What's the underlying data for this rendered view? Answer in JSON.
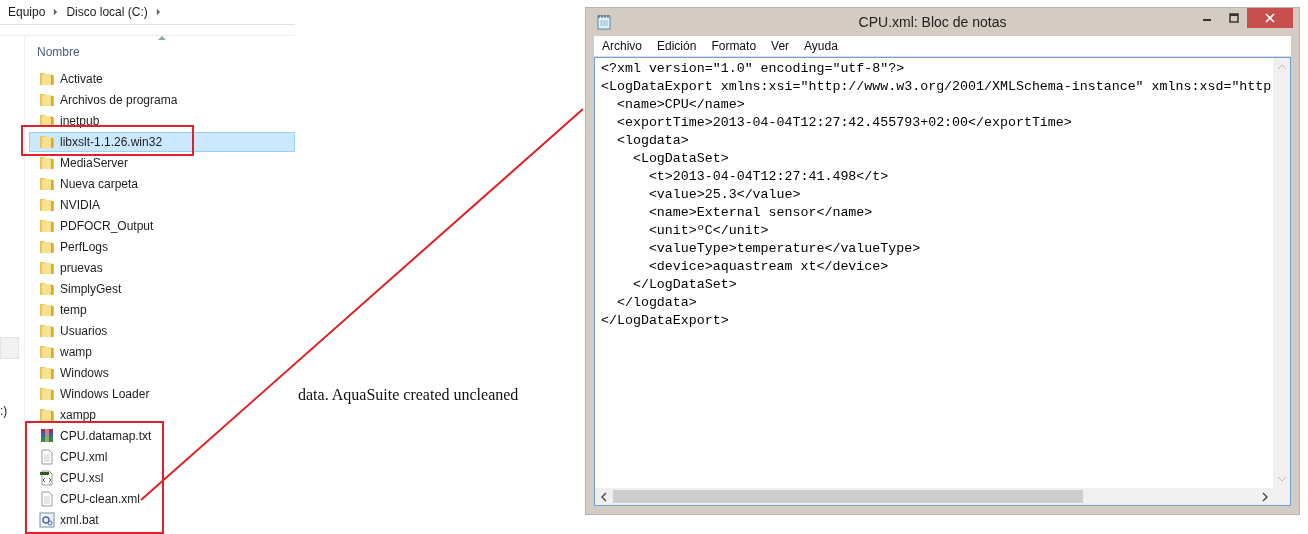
{
  "explorer": {
    "breadcrumb": [
      "Equipo",
      "Disco local (C:)"
    ],
    "column_header": "Nombre",
    "nav_pane_text": ":)",
    "items": [
      {
        "name": "Activate",
        "kind": "folder",
        "selected": false
      },
      {
        "name": "Archivos de programa",
        "kind": "folder",
        "selected": false
      },
      {
        "name": "inetpub",
        "kind": "folder",
        "selected": false
      },
      {
        "name": "libxslt-1.1.26.win32",
        "kind": "folder",
        "selected": true
      },
      {
        "name": "MediaServer",
        "kind": "folder",
        "selected": false
      },
      {
        "name": "Nueva carpeta",
        "kind": "folder",
        "selected": false
      },
      {
        "name": "NVIDIA",
        "kind": "folder",
        "selected": false
      },
      {
        "name": "PDFOCR_Output",
        "kind": "folder",
        "selected": false
      },
      {
        "name": "PerfLogs",
        "kind": "folder",
        "selected": false
      },
      {
        "name": "pruevas",
        "kind": "folder",
        "selected": false
      },
      {
        "name": "SimplyGest",
        "kind": "folder",
        "selected": false
      },
      {
        "name": "temp",
        "kind": "folder",
        "selected": false
      },
      {
        "name": "Usuarios",
        "kind": "folder",
        "selected": false
      },
      {
        "name": "wamp",
        "kind": "folder",
        "selected": false
      },
      {
        "name": "Windows",
        "kind": "folder",
        "selected": false
      },
      {
        "name": "Windows Loader",
        "kind": "folder",
        "selected": false
      },
      {
        "name": "xampp",
        "kind": "folder",
        "selected": false
      },
      {
        "name": "CPU.datamap.txt",
        "kind": "archive",
        "selected": false
      },
      {
        "name": "CPU.xml",
        "kind": "document",
        "selected": false
      },
      {
        "name": "CPU.xsl",
        "kind": "stylesheet",
        "selected": false
      },
      {
        "name": "CPU-clean.xml",
        "kind": "document",
        "selected": false
      },
      {
        "name": "xml.bat",
        "kind": "batch",
        "selected": false
      }
    ]
  },
  "caption": "data. AquaSuite created uncleaned",
  "notepad": {
    "title": "CPU.xml: Bloc de notas",
    "menu": [
      "Archivo",
      "Edición",
      "Formato",
      "Ver",
      "Ayuda"
    ],
    "lines": [
      "<?xml version=\"1.0\" encoding=\"utf-8\"?>",
      "<LogDataExport xmlns:xsi=\"http://www.w3.org/2001/XMLSchema-instance\" xmlns:xsd=\"http",
      "  <name>CPU</name>",
      "  <exportTime>2013-04-04T12:27:42.455793+02:00</exportTime>",
      "  <logdata>",
      "    <LogDataSet>",
      "      <t>2013-04-04T12:27:41.498</t>",
      "      <value>25.3</value>",
      "      <name>External sensor</name>",
      "      <unit>ºC</unit>",
      "      <valueType>temperature</valueType>",
      "      <device>aquastream xt</device>",
      "    </LogDataSet>",
      "  </logdata>",
      "</LogDataExport>"
    ]
  }
}
